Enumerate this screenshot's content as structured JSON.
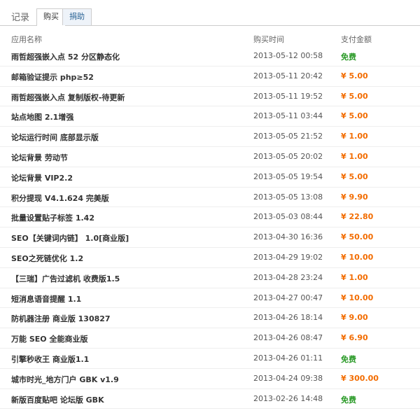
{
  "tabs": {
    "title": "记录",
    "active": "购买",
    "inactive": "捐助"
  },
  "table": {
    "headers": {
      "name": "应用名称",
      "time": "购买时间",
      "amount": "支付金额"
    },
    "rows": [
      {
        "name": "雨哲超强嵌入点 52 分区静态化",
        "time": "2013-05-12 00:58",
        "amount": "免费",
        "free": true
      },
      {
        "name": "邮箱验证提示 php≥52",
        "time": "2013-05-11 20:42",
        "amount": "¥ 5.00",
        "free": false
      },
      {
        "name": "雨哲超强嵌入点 复制版权-待更新",
        "time": "2013-05-11 19:52",
        "amount": "¥ 5.00",
        "free": false
      },
      {
        "name": "站点地图 2.1增强",
        "time": "2013-05-11 03:44",
        "amount": "¥ 5.00",
        "free": false
      },
      {
        "name": "论坛运行时间 底部显示版",
        "time": "2013-05-05 21:52",
        "amount": "¥ 1.00",
        "free": false
      },
      {
        "name": "论坛背景 劳动节",
        "time": "2013-05-05 20:02",
        "amount": "¥ 1.00",
        "free": false
      },
      {
        "name": "论坛背景 VIP2.2",
        "time": "2013-05-05 19:54",
        "amount": "¥ 5.00",
        "free": false
      },
      {
        "name": "积分提现 V4.1.624 完美版",
        "time": "2013-05-05 13:08",
        "amount": "¥ 9.90",
        "free": false
      },
      {
        "name": "批量设置贴子标签 1.42",
        "time": "2013-05-03 08:44",
        "amount": "¥ 22.80",
        "free": false
      },
      {
        "name": "SEO【关键词内链】 1.0[商业版]",
        "time": "2013-04-30 16:36",
        "amount": "¥ 50.00",
        "free": false
      },
      {
        "name": "SEO之死链优化 1.2",
        "time": "2013-04-29 19:02",
        "amount": "¥ 10.00",
        "free": false
      },
      {
        "name": "【三瑞】广告过滤机 收费版1.5",
        "time": "2013-04-28 23:24",
        "amount": "¥ 1.00",
        "free": false
      },
      {
        "name": "短消息语音提醒 1.1",
        "time": "2013-04-27 00:47",
        "amount": "¥ 10.00",
        "free": false
      },
      {
        "name": "防机器注册 商业版 130827",
        "time": "2013-04-26 18:14",
        "amount": "¥ 9.00",
        "free": false
      },
      {
        "name": "万能 SEO 全能商业版",
        "time": "2013-04-26 08:47",
        "amount": "¥ 6.90",
        "free": false
      },
      {
        "name": "引擎秒收王 商业版1.1",
        "time": "2013-04-26 01:11",
        "amount": "免费",
        "free": true
      },
      {
        "name": "城市时光_地方门户 GBK v1.9",
        "time": "2013-04-24 09:38",
        "amount": "¥ 300.00",
        "free": false
      },
      {
        "name": "新版百度贴吧 论坛版 GBK",
        "time": "2013-02-26 14:48",
        "amount": "免费",
        "free": true
      }
    ]
  }
}
